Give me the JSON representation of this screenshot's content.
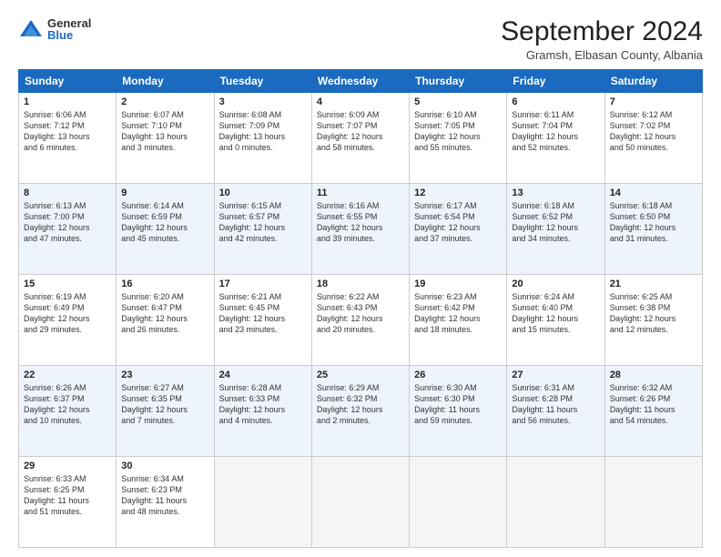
{
  "logo": {
    "general": "General",
    "blue": "Blue"
  },
  "title": "September 2024",
  "subtitle": "Gramsh, Elbasan County, Albania",
  "headers": [
    "Sunday",
    "Monday",
    "Tuesday",
    "Wednesday",
    "Thursday",
    "Friday",
    "Saturday"
  ],
  "weeks": [
    [
      {
        "day": "1",
        "lines": [
          "Sunrise: 6:06 AM",
          "Sunset: 7:12 PM",
          "Daylight: 13 hours",
          "and 6 minutes."
        ]
      },
      {
        "day": "2",
        "lines": [
          "Sunrise: 6:07 AM",
          "Sunset: 7:10 PM",
          "Daylight: 13 hours",
          "and 3 minutes."
        ]
      },
      {
        "day": "3",
        "lines": [
          "Sunrise: 6:08 AM",
          "Sunset: 7:09 PM",
          "Daylight: 13 hours",
          "and 0 minutes."
        ]
      },
      {
        "day": "4",
        "lines": [
          "Sunrise: 6:09 AM",
          "Sunset: 7:07 PM",
          "Daylight: 12 hours",
          "and 58 minutes."
        ]
      },
      {
        "day": "5",
        "lines": [
          "Sunrise: 6:10 AM",
          "Sunset: 7:05 PM",
          "Daylight: 12 hours",
          "and 55 minutes."
        ]
      },
      {
        "day": "6",
        "lines": [
          "Sunrise: 6:11 AM",
          "Sunset: 7:04 PM",
          "Daylight: 12 hours",
          "and 52 minutes."
        ]
      },
      {
        "day": "7",
        "lines": [
          "Sunrise: 6:12 AM",
          "Sunset: 7:02 PM",
          "Daylight: 12 hours",
          "and 50 minutes."
        ]
      }
    ],
    [
      {
        "day": "8",
        "lines": [
          "Sunrise: 6:13 AM",
          "Sunset: 7:00 PM",
          "Daylight: 12 hours",
          "and 47 minutes."
        ]
      },
      {
        "day": "9",
        "lines": [
          "Sunrise: 6:14 AM",
          "Sunset: 6:59 PM",
          "Daylight: 12 hours",
          "and 45 minutes."
        ]
      },
      {
        "day": "10",
        "lines": [
          "Sunrise: 6:15 AM",
          "Sunset: 6:57 PM",
          "Daylight: 12 hours",
          "and 42 minutes."
        ]
      },
      {
        "day": "11",
        "lines": [
          "Sunrise: 6:16 AM",
          "Sunset: 6:55 PM",
          "Daylight: 12 hours",
          "and 39 minutes."
        ]
      },
      {
        "day": "12",
        "lines": [
          "Sunrise: 6:17 AM",
          "Sunset: 6:54 PM",
          "Daylight: 12 hours",
          "and 37 minutes."
        ]
      },
      {
        "day": "13",
        "lines": [
          "Sunrise: 6:18 AM",
          "Sunset: 6:52 PM",
          "Daylight: 12 hours",
          "and 34 minutes."
        ]
      },
      {
        "day": "14",
        "lines": [
          "Sunrise: 6:18 AM",
          "Sunset: 6:50 PM",
          "Daylight: 12 hours",
          "and 31 minutes."
        ]
      }
    ],
    [
      {
        "day": "15",
        "lines": [
          "Sunrise: 6:19 AM",
          "Sunset: 6:49 PM",
          "Daylight: 12 hours",
          "and 29 minutes."
        ]
      },
      {
        "day": "16",
        "lines": [
          "Sunrise: 6:20 AM",
          "Sunset: 6:47 PM",
          "Daylight: 12 hours",
          "and 26 minutes."
        ]
      },
      {
        "day": "17",
        "lines": [
          "Sunrise: 6:21 AM",
          "Sunset: 6:45 PM",
          "Daylight: 12 hours",
          "and 23 minutes."
        ]
      },
      {
        "day": "18",
        "lines": [
          "Sunrise: 6:22 AM",
          "Sunset: 6:43 PM",
          "Daylight: 12 hours",
          "and 20 minutes."
        ]
      },
      {
        "day": "19",
        "lines": [
          "Sunrise: 6:23 AM",
          "Sunset: 6:42 PM",
          "Daylight: 12 hours",
          "and 18 minutes."
        ]
      },
      {
        "day": "20",
        "lines": [
          "Sunrise: 6:24 AM",
          "Sunset: 6:40 PM",
          "Daylight: 12 hours",
          "and 15 minutes."
        ]
      },
      {
        "day": "21",
        "lines": [
          "Sunrise: 6:25 AM",
          "Sunset: 6:38 PM",
          "Daylight: 12 hours",
          "and 12 minutes."
        ]
      }
    ],
    [
      {
        "day": "22",
        "lines": [
          "Sunrise: 6:26 AM",
          "Sunset: 6:37 PM",
          "Daylight: 12 hours",
          "and 10 minutes."
        ]
      },
      {
        "day": "23",
        "lines": [
          "Sunrise: 6:27 AM",
          "Sunset: 6:35 PM",
          "Daylight: 12 hours",
          "and 7 minutes."
        ]
      },
      {
        "day": "24",
        "lines": [
          "Sunrise: 6:28 AM",
          "Sunset: 6:33 PM",
          "Daylight: 12 hours",
          "and 4 minutes."
        ]
      },
      {
        "day": "25",
        "lines": [
          "Sunrise: 6:29 AM",
          "Sunset: 6:32 PM",
          "Daylight: 12 hours",
          "and 2 minutes."
        ]
      },
      {
        "day": "26",
        "lines": [
          "Sunrise: 6:30 AM",
          "Sunset: 6:30 PM",
          "Daylight: 11 hours",
          "and 59 minutes."
        ]
      },
      {
        "day": "27",
        "lines": [
          "Sunrise: 6:31 AM",
          "Sunset: 6:28 PM",
          "Daylight: 11 hours",
          "and 56 minutes."
        ]
      },
      {
        "day": "28",
        "lines": [
          "Sunrise: 6:32 AM",
          "Sunset: 6:26 PM",
          "Daylight: 11 hours",
          "and 54 minutes."
        ]
      }
    ],
    [
      {
        "day": "29",
        "lines": [
          "Sunrise: 6:33 AM",
          "Sunset: 6:25 PM",
          "Daylight: 11 hours",
          "and 51 minutes."
        ]
      },
      {
        "day": "30",
        "lines": [
          "Sunrise: 6:34 AM",
          "Sunset: 6:23 PM",
          "Daylight: 11 hours",
          "and 48 minutes."
        ]
      },
      {
        "day": "",
        "lines": []
      },
      {
        "day": "",
        "lines": []
      },
      {
        "day": "",
        "lines": []
      },
      {
        "day": "",
        "lines": []
      },
      {
        "day": "",
        "lines": []
      }
    ]
  ]
}
